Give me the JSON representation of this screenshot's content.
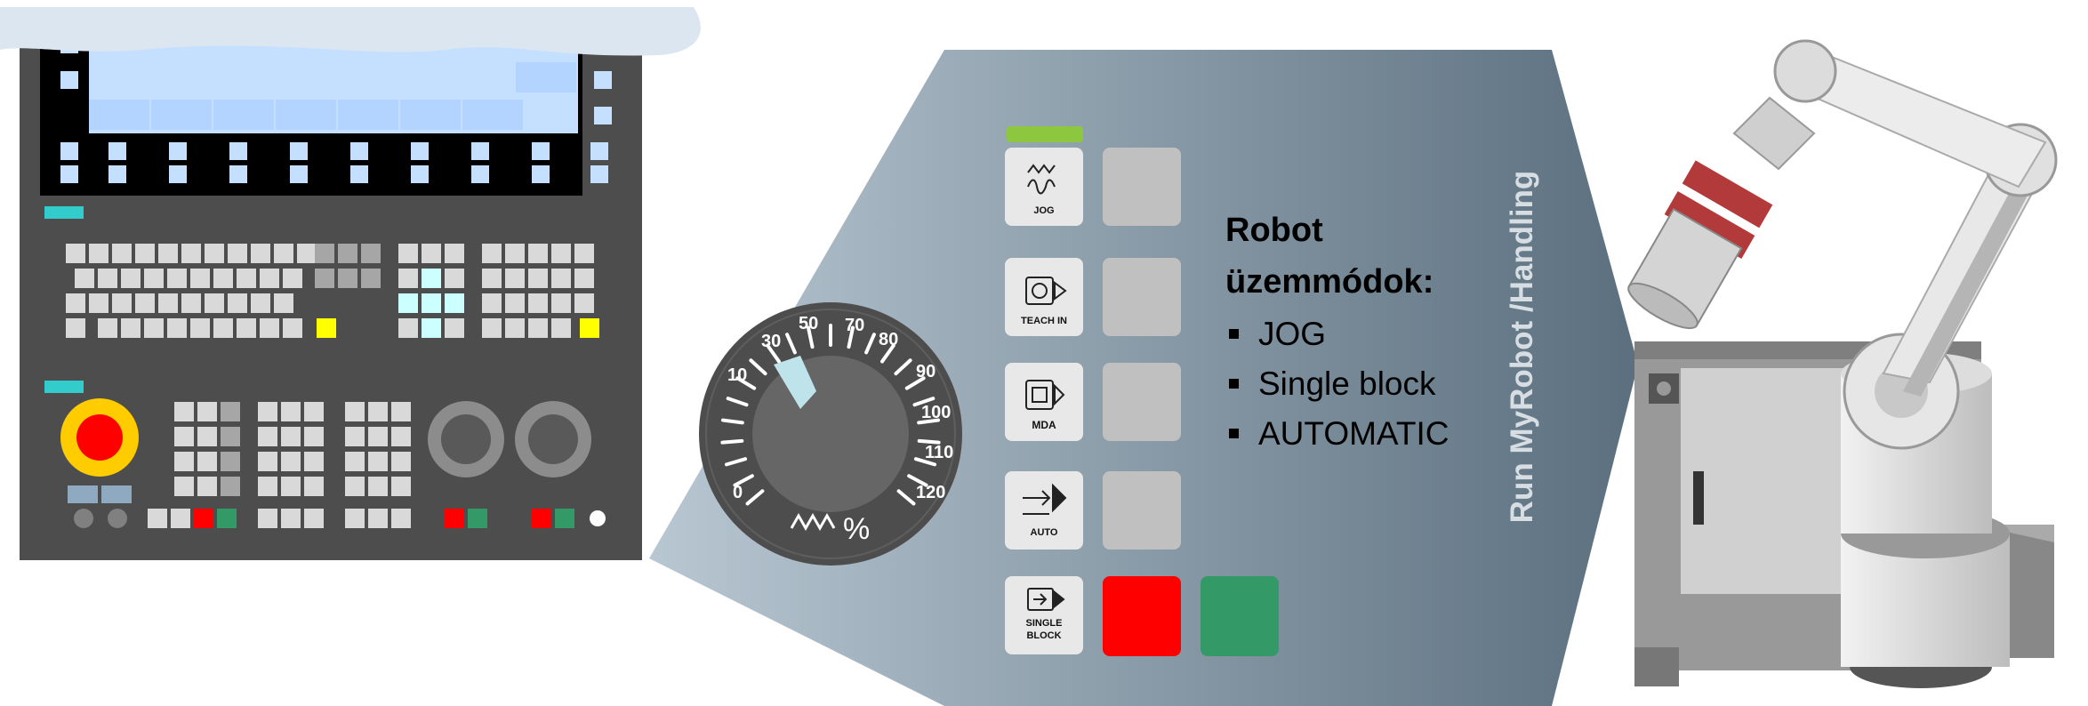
{
  "colors": {
    "panel_dark": "#4d4d4d",
    "screen_bg": "#000000",
    "screen_blue": "#c5e0ff",
    "emergency_red": "#ff0000",
    "emergency_yellow": "#ffcc00",
    "start_green": "#339966",
    "stop_red": "#ff0000",
    "accent_teal": "#33cccc",
    "zoom_gradient_start": "#b8c7d2",
    "zoom_gradient_end": "#5a6e7d",
    "mode_led_green": "#8dc63f"
  },
  "override_dial": {
    "ticks": [
      "0",
      "10",
      "30",
      "50",
      "70",
      "80",
      "90",
      "100",
      "110",
      "120"
    ],
    "unit": "%"
  },
  "mode_buttons": [
    {
      "label": "JOG",
      "icon": "jog-wave-icon"
    },
    {
      "label": "TEACH IN",
      "icon": "teach-in-icon"
    },
    {
      "label": "MDA",
      "icon": "mda-icon"
    },
    {
      "label": "AUTO",
      "icon": "auto-arrow-icon"
    },
    {
      "label": "SINGLE\nBLOCK",
      "icon": "single-block-icon"
    }
  ],
  "modes_text": {
    "title_line1": "Robot",
    "title_line2": "üzemmódok:",
    "items": [
      "JOG",
      "Single block",
      "AUTOMATIC"
    ]
  },
  "vertical_label": "Run MyRobot /Handling"
}
